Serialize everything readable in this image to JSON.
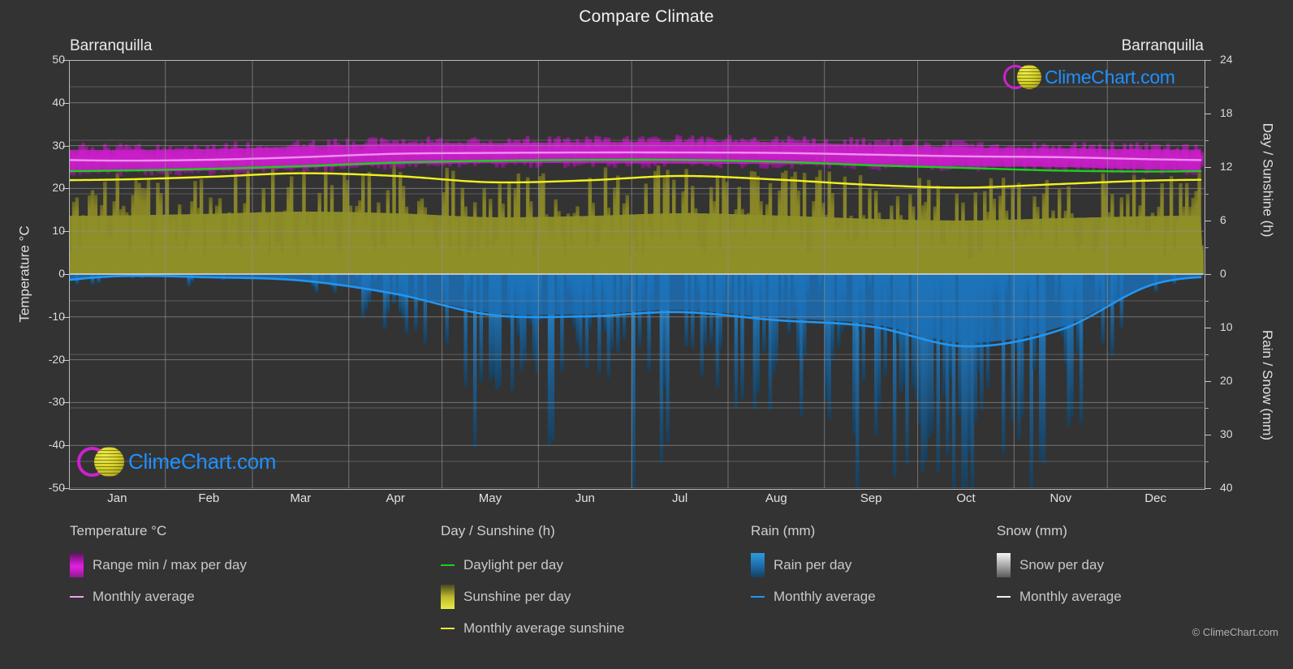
{
  "header": {
    "title": "Compare Climate",
    "city_left": "Barranquilla",
    "city_right": "Barranquilla"
  },
  "axes": {
    "left_title": "Temperature °C",
    "right_title_top": "Day / Sunshine (h)",
    "right_title_bottom": "Rain / Snow (mm)"
  },
  "brand": {
    "name": "ClimeChart.com",
    "copyright": "© ClimeChart.com",
    "ring_color": "#cc22cc",
    "ring_color2": "#7a4bd8",
    "ball_color": "#d6d12a",
    "text_color": "#1e90ff"
  },
  "colors": {
    "background": "#333333",
    "grid": "#8f8f8f",
    "axis": "#b9b9b9",
    "temp_range": "#cc1fcc",
    "temp_avg": "#f08ef0",
    "daylight": "#19d219",
    "sunshine_fill": "#8f8f28",
    "sunshine_avg": "#f0f020",
    "rain_fill": "#1b6fb5",
    "rain_avg": "#2196f3",
    "snow_fill": "#e8e8e8",
    "snow_avg": "#f0f0f0"
  },
  "legend": {
    "columns": [
      {
        "heading": "Temperature °C",
        "items": [
          {
            "label": "Range min / max per day",
            "mark": "gradient",
            "color": "#cc1fcc"
          },
          {
            "label": "Monthly average",
            "mark": "line",
            "color": "#f0a0f0"
          }
        ]
      },
      {
        "heading": "Day / Sunshine (h)",
        "items": [
          {
            "label": "Daylight per day",
            "mark": "line",
            "color": "#19d219"
          },
          {
            "label": "Sunshine per day",
            "mark": "gradient",
            "color": "#e8e83a"
          },
          {
            "label": "Monthly average sunshine",
            "mark": "line",
            "color": "#e8e83a"
          }
        ]
      },
      {
        "heading": "Rain (mm)",
        "items": [
          {
            "label": "Rain per day",
            "mark": "gradient",
            "color": "#1e90ff"
          },
          {
            "label": "Monthly average",
            "mark": "line",
            "color": "#2196f3"
          }
        ]
      },
      {
        "heading": "Snow (mm)",
        "items": [
          {
            "label": "Snow per day",
            "mark": "gradient",
            "color": "#e8e8e8"
          },
          {
            "label": "Monthly average",
            "mark": "line",
            "color": "#f0f0f0"
          }
        ]
      }
    ]
  },
  "chart_data": {
    "type": "area",
    "title": "Compare Climate",
    "subtitle": "Barranquilla",
    "xlabel": "",
    "ylabel": "Temperature °C",
    "grid": true,
    "legend_position": "bottom",
    "categories": [
      "Jan",
      "Feb",
      "Mar",
      "Apr",
      "May",
      "Jun",
      "Jul",
      "Aug",
      "Sep",
      "Oct",
      "Nov",
      "Dec"
    ],
    "axis_left": {
      "label": "Temperature °C",
      "ticks": [
        50,
        40,
        30,
        20,
        10,
        0,
        -10,
        -20,
        -30,
        -40,
        -50
      ],
      "range": [
        -50,
        50
      ],
      "unit": "°C"
    },
    "axis_right_top": {
      "label": "Day / Sunshine (h)",
      "ticks": [
        24,
        18,
        12,
        6,
        0
      ],
      "range": [
        0,
        24
      ],
      "unit": "h"
    },
    "axis_right_bottom": {
      "label": "Rain / Snow (mm)",
      "ticks": [
        0,
        10,
        20,
        30,
        40
      ],
      "range": [
        0,
        40
      ],
      "unit": "mm"
    },
    "series": [
      {
        "name": "Temperature max per day",
        "type": "range-band-upper",
        "color": "#cc1fcc",
        "unit": "°C",
        "values": [
          29.0,
          29.2,
          29.8,
          30.5,
          30.6,
          30.8,
          30.9,
          30.8,
          30.2,
          29.6,
          29.4,
          29.1
        ]
      },
      {
        "name": "Temperature min per day",
        "type": "range-band-lower",
        "color": "#cc1fcc",
        "unit": "°C",
        "values": [
          24.0,
          24.2,
          24.8,
          25.6,
          25.9,
          25.9,
          25.8,
          25.7,
          25.4,
          25.1,
          25.0,
          24.4
        ]
      },
      {
        "name": "Monthly average temperature",
        "type": "line",
        "color": "#f08ef0",
        "unit": "°C",
        "values": [
          26.5,
          26.7,
          27.3,
          28.1,
          28.3,
          28.4,
          28.4,
          28.3,
          27.9,
          27.5,
          27.3,
          26.8
        ]
      },
      {
        "name": "Daylight per day",
        "type": "line",
        "color": "#19d219",
        "unit": "h",
        "values": [
          11.6,
          11.8,
          12.1,
          12.5,
          12.7,
          12.8,
          12.8,
          12.6,
          12.2,
          11.9,
          11.6,
          11.5
        ]
      },
      {
        "name": "Sunshine per day",
        "type": "area",
        "color": "#8f8f28",
        "unit": "h",
        "values": [
          10.6,
          10.9,
          11.3,
          11.0,
          10.3,
          10.5,
          11.0,
          10.6,
          10.0,
          9.7,
          10.1,
          10.5
        ]
      },
      {
        "name": "Monthly average sunshine",
        "type": "line",
        "color": "#f0f020",
        "unit": "h",
        "values": [
          10.6,
          10.9,
          11.3,
          11.0,
          10.3,
          10.5,
          11.0,
          10.6,
          10.0,
          9.7,
          10.1,
          10.5
        ]
      },
      {
        "name": "Monthly average rain",
        "type": "line",
        "color": "#2196f3",
        "unit": "mm",
        "values": [
          0.4,
          0.6,
          1.2,
          3.7,
          7.6,
          7.9,
          7.1,
          8.6,
          9.8,
          13.5,
          10.4,
          1.8
        ]
      },
      {
        "name": "Monthly average snow",
        "type": "line",
        "color": "#f0f0f0",
        "unit": "mm",
        "values": [
          0,
          0,
          0,
          0,
          0,
          0,
          0,
          0,
          0,
          0,
          0,
          0
        ]
      }
    ]
  }
}
